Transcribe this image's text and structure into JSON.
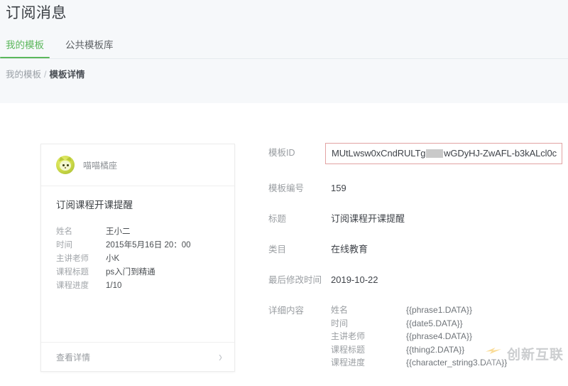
{
  "header": {
    "title": "订阅消息",
    "tabs": [
      {
        "label": "我的模板",
        "active": true
      },
      {
        "label": "公共模板库",
        "active": false
      }
    ],
    "breadcrumb": {
      "parent": "我的模板",
      "separator": "/",
      "current": "模板详情"
    }
  },
  "preview_card": {
    "account_name": "喵喵橘座",
    "avatar_icon": "cat-avatar-icon",
    "title": "订阅课程开课提醒",
    "rows": [
      {
        "key": "姓名",
        "value": "王小二"
      },
      {
        "key": "时间",
        "value": "2015年5月16日 20：00"
      },
      {
        "key": "主讲老师",
        "value": "小K"
      },
      {
        "key": "课程标题",
        "value": "ps入门到精通"
      },
      {
        "key": "课程进度",
        "value": "1/10"
      }
    ],
    "footer": {
      "label": "查看详情",
      "chevron_icon": "chevron-right-icon",
      "chevron_glyph": "›"
    }
  },
  "details": {
    "template_id": {
      "label": "模板ID",
      "prefix": "MUtLwsw0xCndRULTg",
      "redacted": true,
      "suffix": "wGDyHJ-ZwAFL-b3kALcl0c",
      "highlight_color": "#e2a3a3"
    },
    "fields": [
      {
        "label": "模板编号",
        "value": "159"
      },
      {
        "label": "标题",
        "value": "订阅课程开课提醒"
      },
      {
        "label": "类目",
        "value": "在线教育"
      },
      {
        "label": "最后修改时间",
        "value": "2019-10-22"
      }
    ],
    "content": {
      "label": "详细内容",
      "rows": [
        {
          "key": "姓名",
          "value": "{{phrase1.DATA}}"
        },
        {
          "key": "时间",
          "value": "{{date5.DATA}}"
        },
        {
          "key": "主讲老师",
          "value": "{{phrase4.DATA}}"
        },
        {
          "key": "课程标题",
          "value": "{{thing2.DATA}}"
        },
        {
          "key": "课程进度",
          "value": "{{character_string3.DATA}}"
        }
      ]
    }
  },
  "watermark": {
    "text": "创新互联",
    "logo_icon": "lightning-logo-icon"
  },
  "theme": {
    "accent": "#5bb75b",
    "header_bg": "#f6f8fa",
    "highlight_border": "#e2a3a3"
  }
}
